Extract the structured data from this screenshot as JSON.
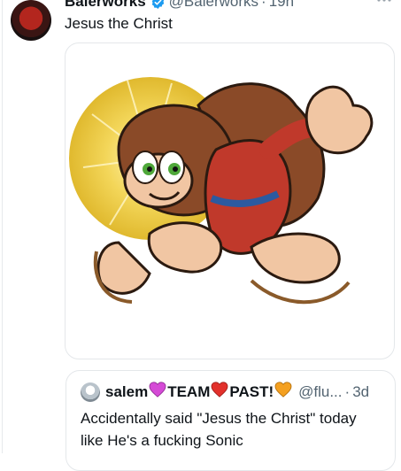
{
  "tweet": {
    "display_name": "Baierworks",
    "handle": "@Baierworks",
    "separator": "·",
    "time": "19h",
    "text": "Jesus the Christ",
    "more_icon": "more-horizontal-icon",
    "verified_color": "#1d9bf0"
  },
  "quoted": {
    "name": "salem",
    "name_mid": "TEAM",
    "name_end": "PAST!",
    "handle": "@flu...",
    "separator": "·",
    "time": "3d",
    "text": "Accidentally said \"Jesus the Christ\" today like He's a fucking Sonic",
    "heart_colors": [
      "#d54ad6",
      "#e2302b",
      "#f4a020"
    ]
  }
}
